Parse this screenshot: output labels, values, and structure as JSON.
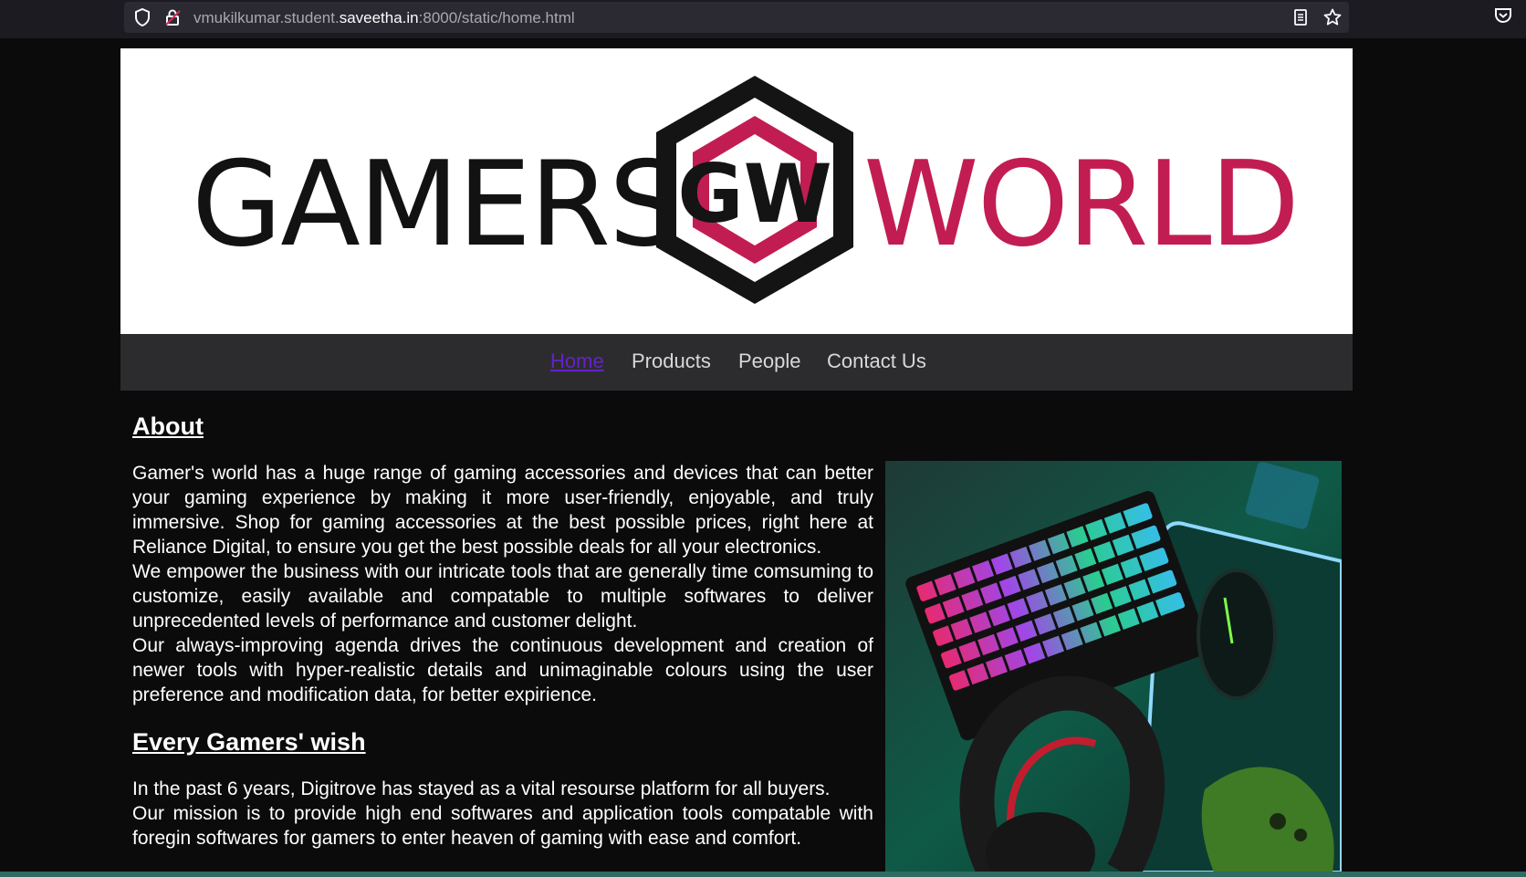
{
  "browser": {
    "url_prefix": "vmukilkumar.student.",
    "url_host": "saveetha.in",
    "url_suffix": ":8000/static/home.html"
  },
  "banner": {
    "logo_left": "GAMERS",
    "logo_mark": "GW",
    "logo_right": "WORLD"
  },
  "nav": {
    "items": [
      {
        "label": "Home",
        "active": true
      },
      {
        "label": "Products"
      },
      {
        "label": "People"
      },
      {
        "label": "Contact Us"
      }
    ]
  },
  "about": {
    "heading": "About",
    "paragraphs": [
      "Gamer's world has a huge range of gaming accessories and devices that can better your gaming experience by making it more user-friendly, enjoyable, and truly immersive. Shop for gaming accessories at the best possible prices, right here at Reliance Digital, to ensure you get the best possible deals for all your electronics.",
      "We empower the business with our intricate tools that are generally time comsuming to customize, easily available and compatable to multiple softwares to deliver unprecedented levels of performance and customer delight.",
      "Our always-improving agenda drives the continuous development and creation of newer tools with hyper-realistic details and unimaginable colours using the user preference and modification data, for better expirience."
    ]
  },
  "wish": {
    "heading": "Every Gamers' wish",
    "paragraphs": [
      "In the past 6 years, Digitrove has stayed as a vital resourse platform for all buyers.",
      "Our mission is to provide high end softwares and application tools compatable with foregin softwares for gamers to enter heaven of gaming with ease and comfort."
    ]
  },
  "colors": {
    "brand_red": "#c21d52",
    "nav_active": "#6422c9",
    "background": "#0b0b0c"
  }
}
